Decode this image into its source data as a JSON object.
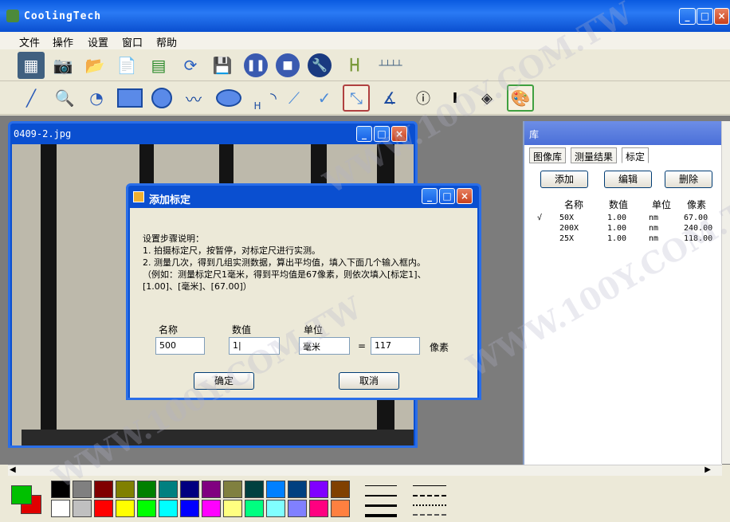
{
  "app": {
    "title": "CoolingTech"
  },
  "menu": [
    "文件",
    "操作",
    "设置",
    "窗口",
    "帮助"
  ],
  "toolbar1": [
    "film-icon",
    "camera-icon",
    "open-folder-icon",
    "document-icon",
    "spreadsheet-icon",
    "rotate-icon",
    "save-icon",
    "pause-icon",
    "stop-icon",
    "wrench-icon",
    "ruler-vertical-icon",
    "ruler-horizontal-icon"
  ],
  "toolbar2": [
    "line-icon",
    "magnifier-icon",
    "pointer-icon",
    "rectangle-icon",
    "circle-icon",
    "polyline-icon",
    "ellipse-icon",
    "h-icon",
    "arc-icon",
    "angle-icon",
    "check-angle-icon",
    "diagonal-icon",
    "angle-measure-icon",
    "circle-i-icon",
    "i-beam-icon",
    "diamond-i-icon",
    "palette-icon"
  ],
  "child_window": {
    "title": "0409-2.jpg"
  },
  "library": {
    "title": "库",
    "tabs": [
      "图像库",
      "测量结果",
      "标定"
    ],
    "buttons": {
      "add": "添加",
      "edit": "编辑",
      "delete": "删除"
    },
    "columns": [
      "名称",
      "数值",
      "单位",
      "像素"
    ],
    "rows": [
      {
        "mark": "√",
        "name": "50X",
        "value": "1.00",
        "unit": "nm",
        "pixels": "67.00"
      },
      {
        "mark": "",
        "name": "200X",
        "value": "1.00",
        "unit": "nm",
        "pixels": "240.00"
      },
      {
        "mark": "",
        "name": "25X",
        "value": "1.00",
        "unit": "nm",
        "pixels": "118.00"
      }
    ]
  },
  "dialog": {
    "title": "添加标定",
    "instructions": [
      "设置步骤说明：",
      "1. 拍摄标定尺，按暂停，对标定尺进行实测。",
      "2. 测量几次，得到几组实测数据，算出平均值，填入下面几个输入框内。",
      "（例如：测量标定尺1毫米，得到平均值是67像素，则依次填入[标定1]、",
      "[1.00]、[毫米]、[67.00]）"
    ],
    "labels": {
      "name": "名称",
      "value": "数值",
      "unit": "单位",
      "equals": "=",
      "pixels": "像素"
    },
    "fields": {
      "name": "500",
      "value": "1|",
      "unit": "毫米",
      "pixels": "117"
    },
    "buttons": {
      "ok": "确定",
      "cancel": "取消"
    }
  },
  "palette": {
    "current_fg": "#00c000",
    "current_bg": "#e00000",
    "row1": [
      "#000000",
      "#808080",
      "#800000",
      "#808000",
      "#008000",
      "#008080",
      "#000080",
      "#800080",
      "#808040",
      "#004040",
      "#0080ff",
      "#004080",
      "#8000ff",
      "#804000"
    ],
    "row2": [
      "#ffffff",
      "#c0c0c0",
      "#ff0000",
      "#ffff00",
      "#00ff00",
      "#00ffff",
      "#0000ff",
      "#ff00ff",
      "#ffff80",
      "#00ff80",
      "#80ffff",
      "#8080ff",
      "#ff0080",
      "#ff8040"
    ]
  },
  "watermark": "WWW.100Y.COM.TW"
}
